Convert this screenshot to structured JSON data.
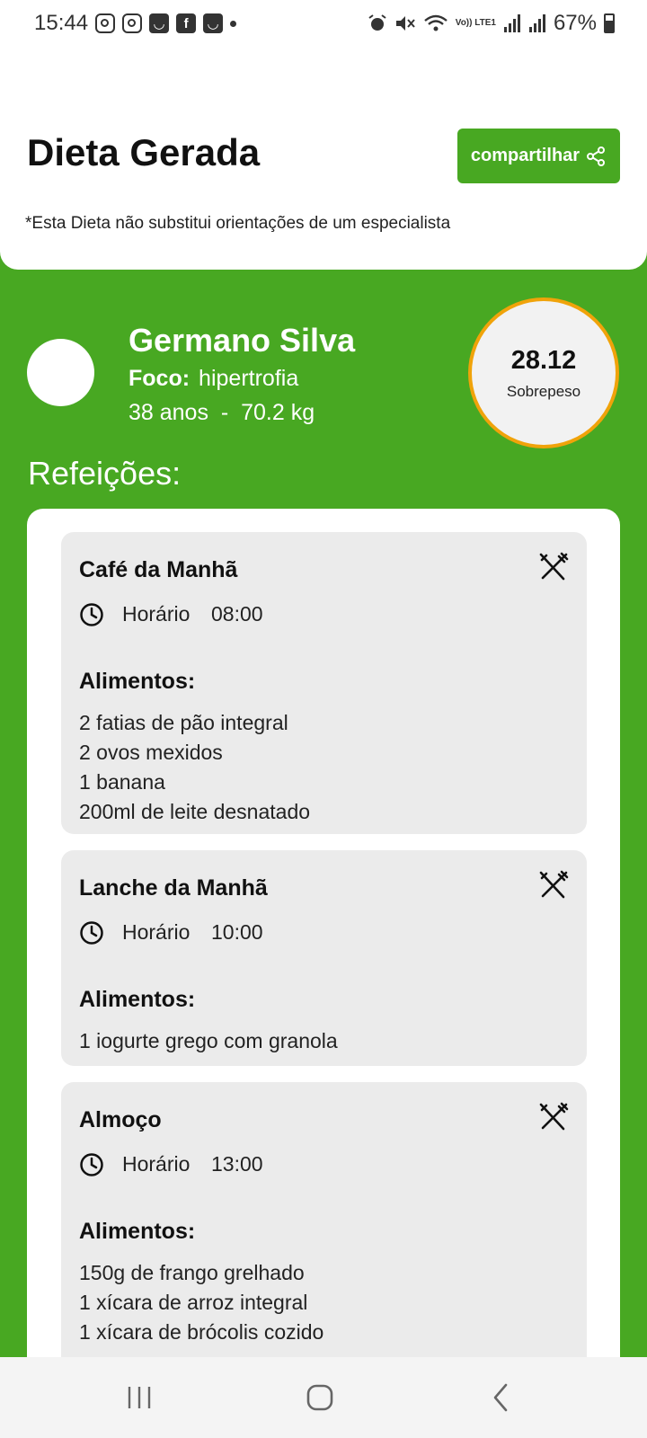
{
  "status_bar": {
    "time": "15:44",
    "left_icons": [
      "instagram-icon",
      "instagram-icon",
      "shopee-icon",
      "facebook-icon",
      "shopee-icon",
      "dot-icon"
    ],
    "right_icons": [
      "alarm-icon",
      "mute-icon",
      "wifi-icon",
      "volte-icon",
      "signal-icon",
      "signal-icon"
    ],
    "network_label": "Vo)) LTE1",
    "battery_percent": "67%",
    "battery_level": 0.67
  },
  "header": {
    "title": "Dieta Gerada",
    "share_label": "compartilhar",
    "share_icon": "share-icon",
    "disclaimer": "*Esta Dieta não substitui orientações de um especialista"
  },
  "profile": {
    "name": "Germano Silva",
    "focus_label": "Foco:",
    "focus_value": "hipertrofia",
    "age": "38 anos",
    "separator": "-",
    "weight": "70.2 kg",
    "bmi_value": "28.12",
    "bmi_label": "Sobrepeso"
  },
  "meals_title": "Refeições:",
  "meals": [
    {
      "name": "Café da Manhã",
      "time_label": "Horário",
      "time": "08:00",
      "foods_title": "Alimentos:",
      "foods": [
        "2 fatias de pão integral",
        "2 ovos mexidos",
        "1 banana",
        "200ml de leite desnatado"
      ]
    },
    {
      "name": "Lanche da Manhã",
      "time_label": "Horário",
      "time": "10:00",
      "foods_title": "Alimentos:",
      "foods": [
        "1 iogurte grego com granola"
      ]
    },
    {
      "name": "Almoço",
      "time_label": "Horário",
      "time": "13:00",
      "foods_title": "Alimentos:",
      "foods": [
        "150g de frango grelhado",
        "1 xícara de arroz integral",
        "1 xícara de brócolis cozido"
      ]
    }
  ],
  "colors": {
    "brand_green": "#48a822",
    "bmi_ring": "#f0a30a",
    "card_bg": "#ebebeb"
  },
  "nav_icons": [
    "recent-apps-icon",
    "home-icon",
    "back-icon"
  ]
}
